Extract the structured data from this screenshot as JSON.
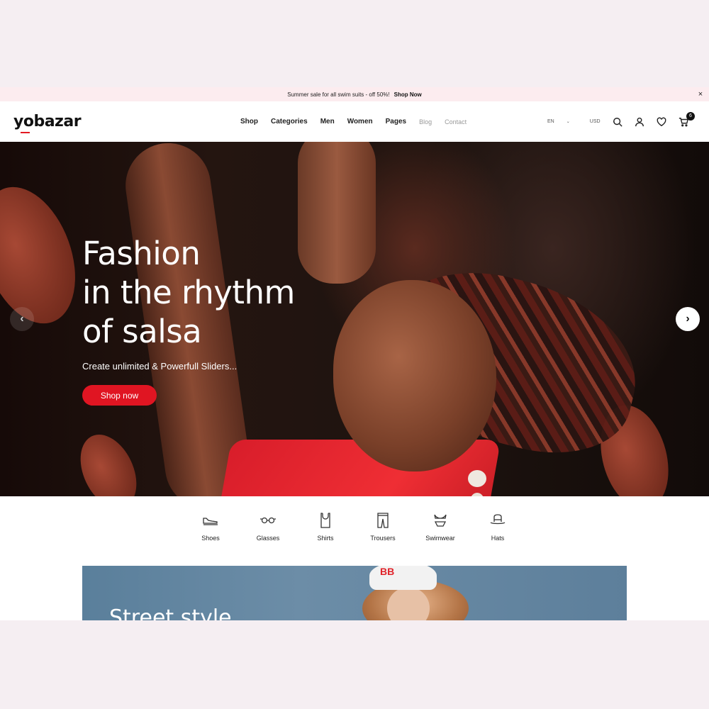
{
  "announcement": {
    "message": "Summer sale for all swim suits - off 50%!",
    "link": "Shop Now",
    "close_icon": "×"
  },
  "header": {
    "logo": "yobazar",
    "nav": [
      "Shop",
      "Categories",
      "Men",
      "Women",
      "Pages",
      "Blog",
      "Contact"
    ],
    "language": "EN",
    "currency": "USD",
    "cart_count": "6"
  },
  "hero": {
    "title_lines": [
      "Fashion",
      "in the rhythm",
      "of salsa"
    ],
    "subtitle": "Create unlimited & Powerfull Sliders...",
    "cta": "Shop now",
    "prev_glyph": "‹",
    "next_glyph": "›"
  },
  "categories": [
    {
      "label": "Shoes",
      "icon": "shoe-icon"
    },
    {
      "label": "Glasses",
      "icon": "glasses-icon"
    },
    {
      "label": "Shirts",
      "icon": "shirt-icon"
    },
    {
      "label": "Trousers",
      "icon": "trousers-icon"
    },
    {
      "label": "Swimwear",
      "icon": "swimwear-icon"
    },
    {
      "label": "Hats",
      "icon": "hat-icon"
    }
  ],
  "banner": {
    "title": "Street style",
    "hat_logo": "BB"
  },
  "colors": {
    "accent": "#e01522",
    "announcement_bg": "#fcecef",
    "page_bg": "#f5eef2"
  }
}
